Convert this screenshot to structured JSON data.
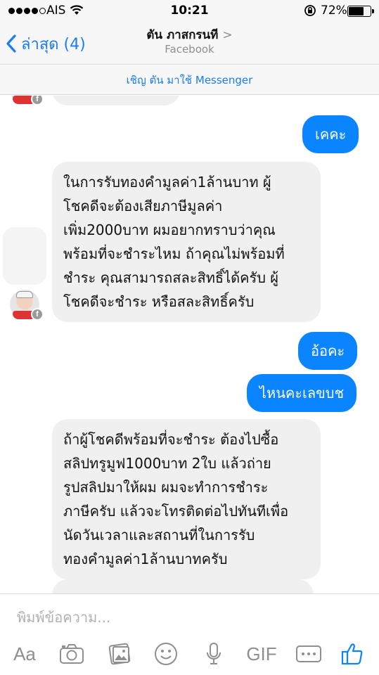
{
  "status_bar": {
    "carrier": "AIS",
    "time": "10:21",
    "battery_percent": "72%",
    "battery_level": 0.72,
    "signal_bars_filled": 4,
    "signal_bars_total": 5,
    "icons": [
      "signal-dots-icon",
      "wifi-icon",
      "rotation-lock-icon",
      "battery-icon"
    ]
  },
  "nav": {
    "back_label": "ล่าสุด (4)",
    "contact_name": "ตัน ภาสกรนที",
    "subtitle": "Facebook",
    "title_chevron": ">"
  },
  "invite_banner": "เชิญ ตัน มาใช้ Messenger",
  "messages": [
    {
      "id": "m1",
      "side": "out",
      "text": "เคคะ"
    },
    {
      "id": "m2",
      "side": "in",
      "lines": [
        "ในการรับทองคำมูลค่า1ล้านบาท ผู้",
        "โชคดีจะต้องเสียภาษีมูลค่า",
        "เพิ่ม2000บาท ผมอยากทราบว่าคุณ",
        "พร้อมที่จะชำระไหม ถ้าคุณไม่พร้อมที่",
        "ชำระ คุณสามารถสละสิทธิ์ได้ครับ ผู้",
        "โชคดีจะชำระ หรือสละสิทธิ์ครับ"
      ]
    },
    {
      "id": "m3",
      "side": "out",
      "text": "อ้อคะ"
    },
    {
      "id": "m4",
      "side": "out",
      "text": "ไหนคะเลขบช"
    },
    {
      "id": "m5",
      "side": "in",
      "lines": [
        "ถ้าผู้โชคดีพร้อมที่จะชำระ ต้องไปซื้อ",
        "สลิปทรูมูฟ1000บาท 2ใบ แล้วถ่าย",
        "รูปสลิปมาให้ผม ผมจะทำการชำระ",
        "ภาษีครับ แล้วจะโทรติดต่อไปทันทีเพื่อ",
        "นัดวันเวลาและสถานที่ในการรับ",
        "ทองคำมูลค่า1ล้านบาทครับ"
      ]
    }
  ],
  "composer": {
    "placeholder": "พิมพ์ข้อความ...",
    "text_tool_label": "Aa",
    "gif_label": "GIF"
  },
  "colors": {
    "accent": "#0a84ff",
    "link": "#1c7cf2",
    "incoming_bubble": "#f1f0f0",
    "bar_background": "#f7f7f7",
    "icon_gray": "#8e8e93"
  }
}
